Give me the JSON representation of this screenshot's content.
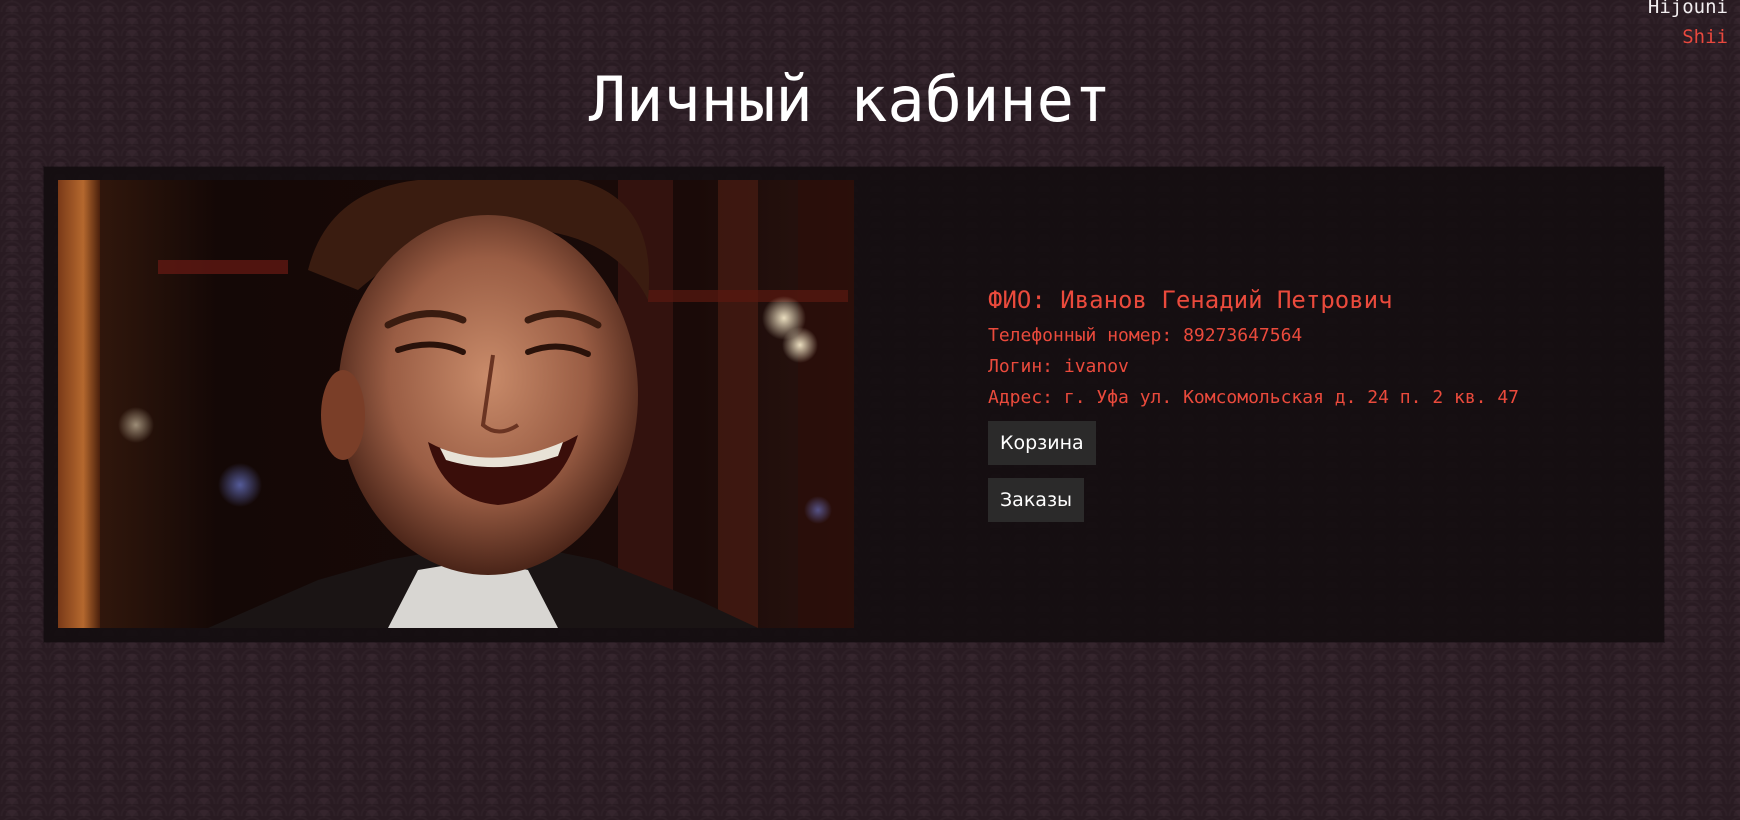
{
  "header": {
    "user_name": "Hijouni",
    "logout_label": "Shii"
  },
  "page": {
    "title": "Личный кабинет"
  },
  "profile": {
    "fio": "ФИО: Иванов Генадий Петрович",
    "phone": "Телефонный номер: 89273647564",
    "login": "Логин: ivanov",
    "address": "Адрес: г. Уфа ул. Комсомольская д. 24 п. 2 кв. 47"
  },
  "actions": {
    "cart_label": "Корзина",
    "orders_label": "Заказы"
  },
  "colors": {
    "background": "#2e1e26",
    "card": "#140d10",
    "accent": "#ea4a3c",
    "button": "#2b2a2a"
  }
}
